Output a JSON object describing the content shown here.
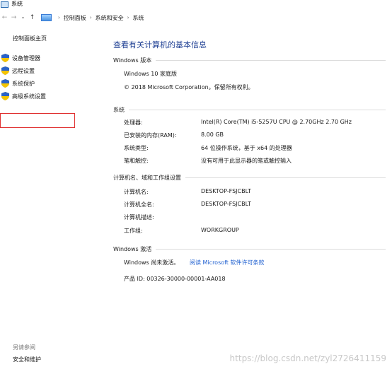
{
  "window": {
    "title": "系统"
  },
  "nav": {
    "breadcrumb": [
      "控制面板",
      "系统和安全",
      "系统"
    ]
  },
  "sidebar": {
    "home": "控制面板主页",
    "items": [
      {
        "label": "设备管理器"
      },
      {
        "label": "远程设置"
      },
      {
        "label": "系统保护"
      },
      {
        "label": "高级系统设置"
      }
    ],
    "see_also_label": "另请参阅",
    "see_also_items": [
      {
        "label": "安全和维护"
      }
    ]
  },
  "main": {
    "heading": "查看有关计算机的基本信息",
    "windows_edition": {
      "section": "Windows 版本",
      "edition": "Windows 10 家庭版",
      "copyright": "© 2018 Microsoft Corporation。保留所有权利。"
    },
    "system": {
      "section": "系统",
      "rows": [
        {
          "label": "处理器:",
          "value": "Intel(R) Core(TM) i5-5257U CPU @ 2.70GHz   2.70 GHz"
        },
        {
          "label": "已安装的内存(RAM):",
          "value": "8.00 GB"
        },
        {
          "label": "系统类型:",
          "value": "64 位操作系统，基于 x64 的处理器"
        },
        {
          "label": "笔和触控:",
          "value": "没有可用于此显示器的笔或触控输入"
        }
      ]
    },
    "computer": {
      "section": "计算机名、域和工作组设置",
      "rows": [
        {
          "label": "计算机名:",
          "value": "DESKTOP-FSJCBLT"
        },
        {
          "label": "计算机全名:",
          "value": "DESKTOP-FSJCBLT"
        },
        {
          "label": "计算机描述:",
          "value": ""
        },
        {
          "label": "工作组:",
          "value": "WORKGROUP"
        }
      ]
    },
    "activation": {
      "section": "Windows 激活",
      "status": "Windows 尚未激活。",
      "license_link": "阅读 Microsoft 软件许可条款",
      "product_id": "产品 ID: 00326-30000-00001-AA018"
    }
  },
  "watermark": "https://blog.csdn.net/zyl2726411159",
  "colors": {
    "heading": "#1e3f93",
    "link": "#1e5fd0",
    "highlight": "#e03030"
  }
}
